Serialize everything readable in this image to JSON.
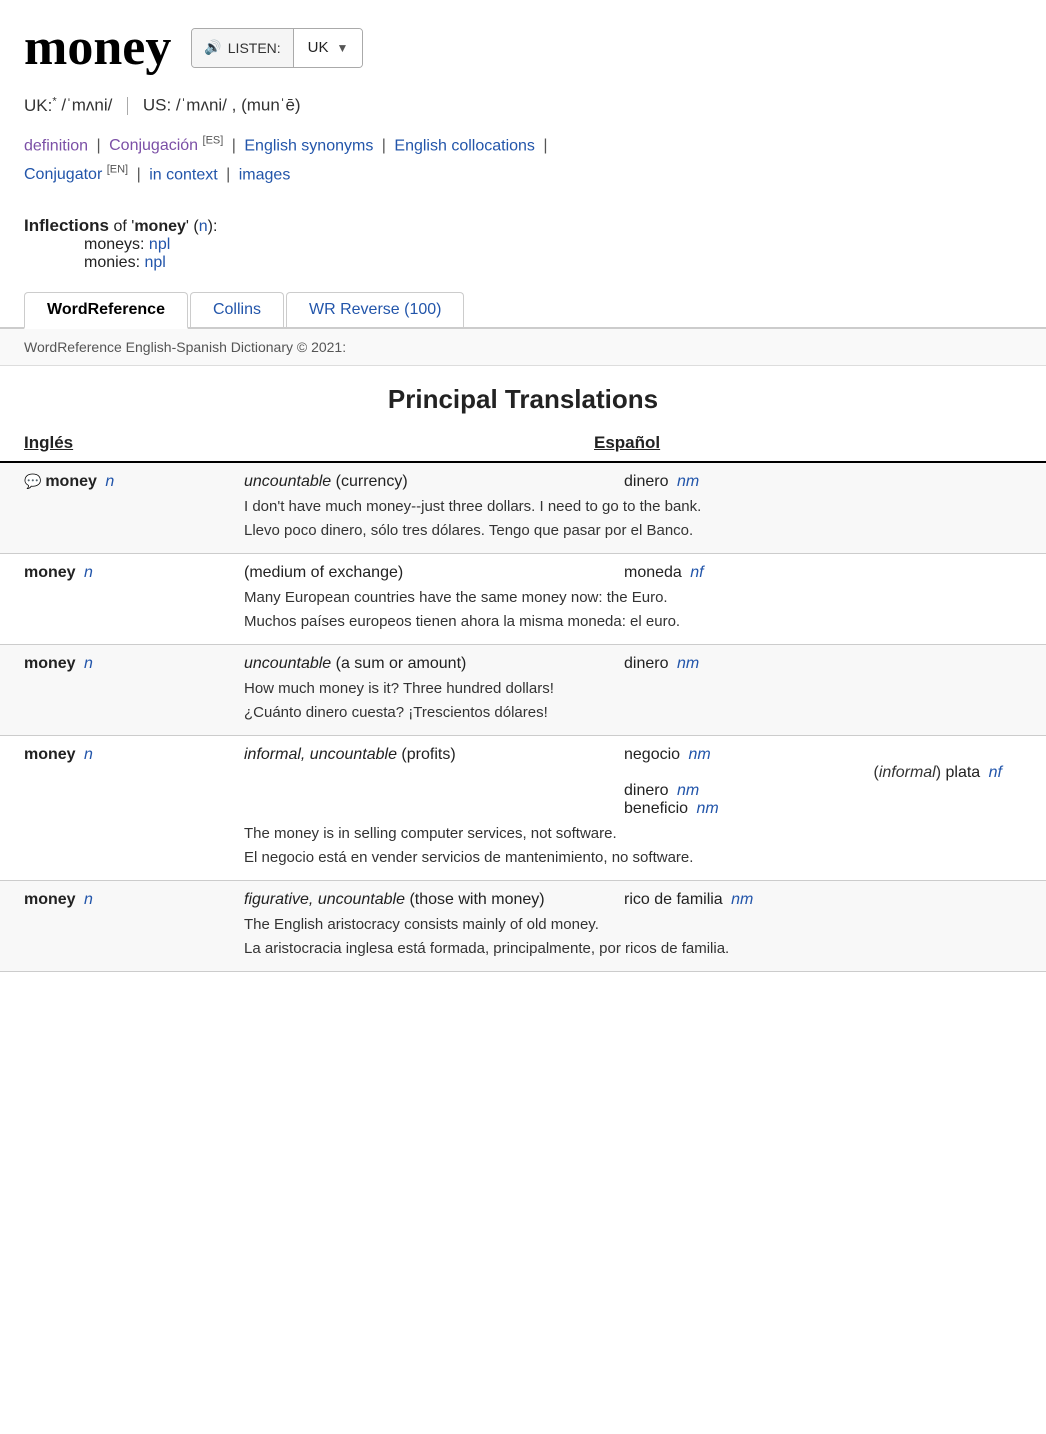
{
  "header": {
    "word": "money",
    "listen_label": "LISTEN:",
    "uk_label": "UK"
  },
  "pronunciation": {
    "uk_label": "UK:",
    "uk_asterisk": "*",
    "uk_ipa": "/ˈmʌni/",
    "us_label": "US:",
    "us_ipa": "/ˈmʌni/ ,  (munˈē)"
  },
  "links": [
    {
      "text": "definition",
      "class": "link-purple"
    },
    {
      "text": "Conjugación",
      "badge": "ES",
      "class": "link-purple"
    },
    {
      "text": "English synonyms",
      "class": "link-blue"
    },
    {
      "text": "English collocations",
      "class": "link-blue"
    },
    {
      "text": "Conjugator",
      "badge": "EN",
      "class": "link-blue"
    },
    {
      "text": "in context",
      "class": "link-blue"
    },
    {
      "text": "images",
      "class": "link-blue"
    }
  ],
  "inflections": {
    "title": "Inflections",
    "word": "money",
    "pos": "n",
    "items": [
      {
        "form": "moneys:",
        "tag": "npl"
      },
      {
        "form": "monies:",
        "tag": "npl"
      }
    ]
  },
  "tabs": [
    {
      "label": "WordReference",
      "active": true
    },
    {
      "label": "Collins",
      "active": false
    },
    {
      "label": "WR Reverse (100)",
      "active": false
    }
  ],
  "copyright": "WordReference English-Spanish Dictionary © 2021:",
  "section_title": "Principal Translations",
  "col_ingles": "Inglés",
  "col_espanol": "Español",
  "entries": [
    {
      "has_chat_icon": true,
      "en_word": "money",
      "en_pos": "n",
      "definition": "uncountable (currency)",
      "es_word": "dinero",
      "es_tag": "nm",
      "example_en": "I don't have much money--just three dollars. I need to go to the bank.",
      "example_es": "Llevo poco dinero, sólo tres dólares. Tengo que pasar por el Banco."
    },
    {
      "has_chat_icon": false,
      "en_word": "money",
      "en_pos": "n",
      "definition": "(medium of exchange)",
      "es_word": "moneda",
      "es_tag": "nf",
      "example_en": "Many European countries have the same money now: the Euro.",
      "example_es": "Muchos países europeos tienen ahora la misma moneda: el euro."
    },
    {
      "has_chat_icon": false,
      "en_word": "money",
      "en_pos": "n",
      "definition": "uncountable (a sum or amount)",
      "es_word": "dinero",
      "es_tag": "nm",
      "example_en": "How much money is it? Three hundred dollars!",
      "example_es": "¿Cuánto dinero cuesta? ¡Trescientos dólares!"
    },
    {
      "has_chat_icon": false,
      "en_word": "money",
      "en_pos": "n",
      "definition": "informal, uncountable (profits)",
      "es_extra": [
        {
          "word": "negocio",
          "tag": "nm"
        },
        {
          "word": "plata",
          "tag": "nf",
          "prefix": "(informal)"
        },
        {
          "word": "dinero",
          "tag": "nm"
        },
        {
          "word": "beneficio",
          "tag": "nm"
        }
      ],
      "example_en": "The money is in selling computer services, not software.",
      "example_es": "El negocio está en vender servicios de mantenimiento, no software."
    },
    {
      "has_chat_icon": false,
      "en_word": "money",
      "en_pos": "n",
      "definition": "figurative, uncountable (those with money)",
      "es_word": "rico de familia",
      "es_tag": "nm",
      "example_en": "The English aristocracy consists mainly of old money.",
      "example_es": "La aristocracia inglesa está formada, principalmente, por ricos de familia."
    }
  ]
}
